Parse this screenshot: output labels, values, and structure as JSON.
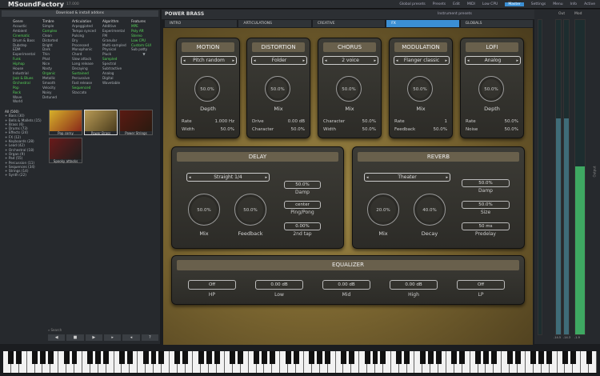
{
  "app": {
    "name": "MSoundFactory",
    "version": "17.000",
    "menu": [
      "Global presets",
      "Presets",
      "Edit",
      "MIDI",
      "Settings",
      "Menu",
      "Info"
    ],
    "active_menu": "Master",
    "status": "Low CPU",
    "extra": "Active"
  },
  "browser": {
    "download_label": "Download & install addons",
    "genre": {
      "title": "Genre",
      "items": [
        "Acoustic",
        "Ambient",
        "Cinematic",
        "Drum & Bass",
        "Dubstep",
        "EDM",
        "Experimental",
        "Funk",
        "Hiphop",
        "House",
        "Industrial",
        "Jazz & Blues",
        "Orchestral",
        "Pop",
        "Rock",
        "Wave",
        "World"
      ]
    },
    "timbre": {
      "title": "Timbre",
      "items": [
        "Simple",
        "Complex",
        "Clean",
        "Distorted",
        "Bright",
        "Dark",
        "Thin",
        "Phat",
        "Nice",
        "Nasty",
        "Organic",
        "Metallic",
        "Smooth",
        "Velocity",
        "Noisy",
        "Detuned"
      ]
    },
    "articulation": {
      "title": "Articulation",
      "items": [
        "Arpeggiated",
        "Tempo synced",
        "Pulsing",
        "Dry",
        "Processed",
        "Monophonic",
        "Chord",
        "Slow attack",
        "Long release",
        "Decaying",
        "Sustained",
        "Percussive",
        "Fast release",
        "Sequenced",
        "Staccato"
      ]
    },
    "algorithm": {
      "title": "Algorithm",
      "items": [
        "Additive",
        "Experimental",
        "FM",
        "Granular",
        "Multi-sampled",
        "Physical",
        "Pluck",
        "Sampled",
        "Spectral",
        "Subtractive",
        "Analog",
        "Digital",
        "Wavetable"
      ]
    },
    "features": {
      "title": "Features",
      "items": [
        "MPE",
        "Poly Aft",
        "Stereo",
        "Low CPU",
        "Custom GUI",
        "Sub patty"
      ]
    },
    "tree": [
      "Bass",
      "Bells & Mallets",
      "Brass",
      "Drums",
      "Effects",
      "FX",
      "Keyboards",
      "Lead",
      "Orchestral",
      "Organ",
      "Pad",
      "Percussion",
      "Sequences",
      "Strings",
      "Synth"
    ],
    "tree_counts": [
      "(30)",
      "(15)",
      "(6)",
      "(73)",
      "(24)",
      "(12)",
      "(28)",
      "(42)",
      "(18)",
      "(9)",
      "(55)",
      "(11)",
      "(34)",
      "(14)",
      "(22)"
    ],
    "tree_root": "All (500)",
    "thumbs": [
      "Pop corny",
      "Power Brass",
      "Power Strings",
      "Spooky attacks"
    ],
    "search_label": "Search",
    "buttons": [
      "◀",
      "■",
      "▶",
      "▸",
      "◂",
      "?"
    ]
  },
  "main": {
    "title": "POWER BRASS",
    "instrument_presets": "Instrument presets",
    "tabs": [
      "INTRO",
      "ARTICULATIONS",
      "CREATIVE",
      "FX",
      "GLOBALS"
    ],
    "active_tab": "FX",
    "modules": [
      {
        "title": "MOTION",
        "select": "Pitch random",
        "knob_value": "50.0%",
        "knob_label": "Depth",
        "params": [
          [
            "Rate",
            "1.000 Hz"
          ],
          [
            "Width",
            "50.0%"
          ]
        ]
      },
      {
        "title": "DISTORTION",
        "select": "Folder",
        "knob_value": "50.0%",
        "knob_label": "Mix",
        "params": [
          [
            "Drive",
            "0.00 dB"
          ],
          [
            "Character",
            "50.0%"
          ]
        ]
      },
      {
        "title": "CHORUS",
        "select": "2 voice",
        "knob_value": "50.0%",
        "knob_label": "Mix",
        "params": [
          [
            "Character",
            "50.0%"
          ],
          [
            "Width",
            "50.0%"
          ]
        ]
      },
      {
        "title": "MODULATION",
        "select": "Flanger classic",
        "knob_value": "50.0%",
        "knob_label": "Mix",
        "params": [
          [
            "Rate",
            "1"
          ],
          [
            "Feedback",
            "50.0%"
          ]
        ]
      },
      {
        "title": "LOFI",
        "select": "Analog",
        "knob_value": "50.0%",
        "knob_label": "Depth",
        "params": [
          [
            "Rate",
            "50.0%"
          ],
          [
            "Noise",
            "50.0%"
          ]
        ]
      }
    ],
    "delay": {
      "title": "DELAY",
      "select": "Straight 1/4",
      "mix_value": "50.0%",
      "mix_label": "Mix",
      "feedback_value": "50.0%",
      "feedback_label": "Feedback",
      "damp_value": "50.0%",
      "damp_label": "Damp",
      "pingpong_value": "center",
      "pingpong_label": "Ping/Pong",
      "tap_value": "0.00%",
      "tap_label": "2nd tap"
    },
    "reverb": {
      "title": "REVERB",
      "select": "Theater",
      "mix_value": "20.0%",
      "mix_label": "Mix",
      "decay_value": "40.0%",
      "decay_label": "Decay",
      "damp_value": "50.0%",
      "damp_label": "Damp",
      "size_value": "50.0%",
      "size_label": "Size",
      "predelay_value": "50 ms",
      "predelay_label": "Predelay"
    },
    "eq": {
      "title": "EQUALIZER",
      "bands": [
        [
          "Off",
          "HP"
        ],
        [
          "0.00 dB",
          "Low"
        ],
        [
          "0.00 dB",
          "Mid"
        ],
        [
          "0.00 dB",
          "High"
        ],
        [
          "Off",
          "LP"
        ]
      ]
    }
  },
  "meters": {
    "labels": [
      "Out",
      "Mod"
    ],
    "bottom": [
      "-14.5",
      "-14.3",
      "-1.9"
    ],
    "side_label": "Output"
  },
  "colors": {
    "accent": "#3b8fd4",
    "green": "#58d65a",
    "panel": "#3d3c36"
  }
}
